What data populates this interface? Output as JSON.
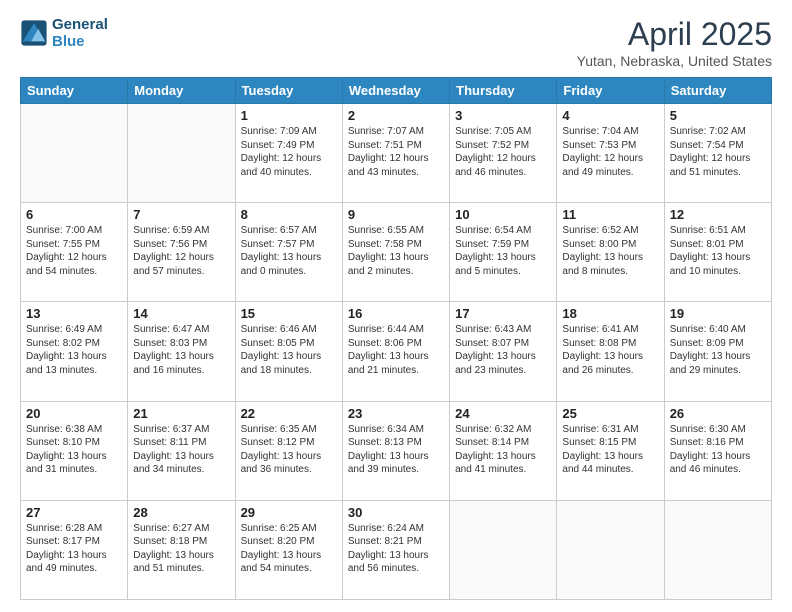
{
  "header": {
    "logo_line1": "General",
    "logo_line2": "Blue",
    "month": "April 2025",
    "location": "Yutan, Nebraska, United States"
  },
  "weekdays": [
    "Sunday",
    "Monday",
    "Tuesday",
    "Wednesday",
    "Thursday",
    "Friday",
    "Saturday"
  ],
  "weeks": [
    [
      {
        "day": "",
        "info": ""
      },
      {
        "day": "",
        "info": ""
      },
      {
        "day": "1",
        "info": "Sunrise: 7:09 AM\nSunset: 7:49 PM\nDaylight: 12 hours\nand 40 minutes."
      },
      {
        "day": "2",
        "info": "Sunrise: 7:07 AM\nSunset: 7:51 PM\nDaylight: 12 hours\nand 43 minutes."
      },
      {
        "day": "3",
        "info": "Sunrise: 7:05 AM\nSunset: 7:52 PM\nDaylight: 12 hours\nand 46 minutes."
      },
      {
        "day": "4",
        "info": "Sunrise: 7:04 AM\nSunset: 7:53 PM\nDaylight: 12 hours\nand 49 minutes."
      },
      {
        "day": "5",
        "info": "Sunrise: 7:02 AM\nSunset: 7:54 PM\nDaylight: 12 hours\nand 51 minutes."
      }
    ],
    [
      {
        "day": "6",
        "info": "Sunrise: 7:00 AM\nSunset: 7:55 PM\nDaylight: 12 hours\nand 54 minutes."
      },
      {
        "day": "7",
        "info": "Sunrise: 6:59 AM\nSunset: 7:56 PM\nDaylight: 12 hours\nand 57 minutes."
      },
      {
        "day": "8",
        "info": "Sunrise: 6:57 AM\nSunset: 7:57 PM\nDaylight: 13 hours\nand 0 minutes."
      },
      {
        "day": "9",
        "info": "Sunrise: 6:55 AM\nSunset: 7:58 PM\nDaylight: 13 hours\nand 2 minutes."
      },
      {
        "day": "10",
        "info": "Sunrise: 6:54 AM\nSunset: 7:59 PM\nDaylight: 13 hours\nand 5 minutes."
      },
      {
        "day": "11",
        "info": "Sunrise: 6:52 AM\nSunset: 8:00 PM\nDaylight: 13 hours\nand 8 minutes."
      },
      {
        "day": "12",
        "info": "Sunrise: 6:51 AM\nSunset: 8:01 PM\nDaylight: 13 hours\nand 10 minutes."
      }
    ],
    [
      {
        "day": "13",
        "info": "Sunrise: 6:49 AM\nSunset: 8:02 PM\nDaylight: 13 hours\nand 13 minutes."
      },
      {
        "day": "14",
        "info": "Sunrise: 6:47 AM\nSunset: 8:03 PM\nDaylight: 13 hours\nand 16 minutes."
      },
      {
        "day": "15",
        "info": "Sunrise: 6:46 AM\nSunset: 8:05 PM\nDaylight: 13 hours\nand 18 minutes."
      },
      {
        "day": "16",
        "info": "Sunrise: 6:44 AM\nSunset: 8:06 PM\nDaylight: 13 hours\nand 21 minutes."
      },
      {
        "day": "17",
        "info": "Sunrise: 6:43 AM\nSunset: 8:07 PM\nDaylight: 13 hours\nand 23 minutes."
      },
      {
        "day": "18",
        "info": "Sunrise: 6:41 AM\nSunset: 8:08 PM\nDaylight: 13 hours\nand 26 minutes."
      },
      {
        "day": "19",
        "info": "Sunrise: 6:40 AM\nSunset: 8:09 PM\nDaylight: 13 hours\nand 29 minutes."
      }
    ],
    [
      {
        "day": "20",
        "info": "Sunrise: 6:38 AM\nSunset: 8:10 PM\nDaylight: 13 hours\nand 31 minutes."
      },
      {
        "day": "21",
        "info": "Sunrise: 6:37 AM\nSunset: 8:11 PM\nDaylight: 13 hours\nand 34 minutes."
      },
      {
        "day": "22",
        "info": "Sunrise: 6:35 AM\nSunset: 8:12 PM\nDaylight: 13 hours\nand 36 minutes."
      },
      {
        "day": "23",
        "info": "Sunrise: 6:34 AM\nSunset: 8:13 PM\nDaylight: 13 hours\nand 39 minutes."
      },
      {
        "day": "24",
        "info": "Sunrise: 6:32 AM\nSunset: 8:14 PM\nDaylight: 13 hours\nand 41 minutes."
      },
      {
        "day": "25",
        "info": "Sunrise: 6:31 AM\nSunset: 8:15 PM\nDaylight: 13 hours\nand 44 minutes."
      },
      {
        "day": "26",
        "info": "Sunrise: 6:30 AM\nSunset: 8:16 PM\nDaylight: 13 hours\nand 46 minutes."
      }
    ],
    [
      {
        "day": "27",
        "info": "Sunrise: 6:28 AM\nSunset: 8:17 PM\nDaylight: 13 hours\nand 49 minutes."
      },
      {
        "day": "28",
        "info": "Sunrise: 6:27 AM\nSunset: 8:18 PM\nDaylight: 13 hours\nand 51 minutes."
      },
      {
        "day": "29",
        "info": "Sunrise: 6:25 AM\nSunset: 8:20 PM\nDaylight: 13 hours\nand 54 minutes."
      },
      {
        "day": "30",
        "info": "Sunrise: 6:24 AM\nSunset: 8:21 PM\nDaylight: 13 hours\nand 56 minutes."
      },
      {
        "day": "",
        "info": ""
      },
      {
        "day": "",
        "info": ""
      },
      {
        "day": "",
        "info": ""
      }
    ]
  ]
}
